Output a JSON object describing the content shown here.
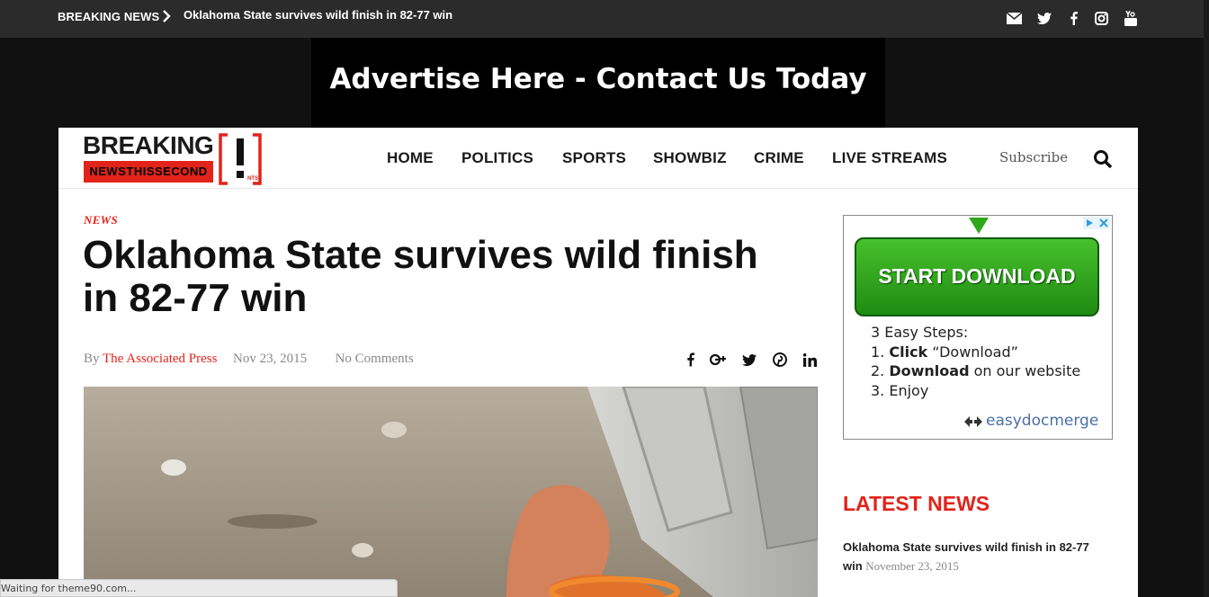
{
  "breaking_bar": {
    "label": "BREAKING NEWS",
    "headline": "Oklahoma State survives wild finish in 82-77 win",
    "social_icons": [
      "email-icon",
      "twitter-icon",
      "facebook-icon",
      "instagram-icon",
      "youtube-icon"
    ]
  },
  "ad_banner": {
    "text": "Advertise Here - Contact Us Today"
  },
  "logo": {
    "word": "BREAKING",
    "tagline": "NEWSTHISSECOND",
    "mark_small": "NTS"
  },
  "nav": {
    "items": [
      "HOME",
      "POLITICS",
      "SPORTS",
      "SHOWBIZ",
      "CRIME",
      "LIVE STREAMS"
    ],
    "subscribe": "Subscribe"
  },
  "article": {
    "category": "NEWS",
    "title": "Oklahoma State survives wild finish in 82-77 win",
    "by": "By",
    "author": "The Associated Press",
    "date": "Nov 23, 2015",
    "comments": "No Comments",
    "share_icons": [
      "facebook-icon",
      "google-plus-icon",
      "twitter-icon",
      "pinterest-icon",
      "linkedin-icon"
    ]
  },
  "sidebar_ad": {
    "button": "START DOWNLOAD",
    "steps_title": "3 Easy Steps:",
    "steps": [
      {
        "num": "1.",
        "bold": "Click",
        "rest": " “Download”"
      },
      {
        "num": "2.",
        "bold": "Download",
        "rest": " on our website"
      },
      {
        "num": "3.",
        "bold": "",
        "rest": " Enjoy"
      }
    ],
    "brand": "easydocmerge"
  },
  "latest_news": {
    "heading": "LATEST NEWS",
    "items": [
      {
        "title": "Oklahoma State survives wild finish in 82-77 win",
        "date": "November 23, 2015"
      }
    ]
  },
  "status_bar": {
    "text": "Waiting for theme90.com..."
  },
  "colors": {
    "accent_red": "#e2231a",
    "top_bar": "#2b2b2b",
    "background": "#111111",
    "download_green": "#2fa81c"
  }
}
